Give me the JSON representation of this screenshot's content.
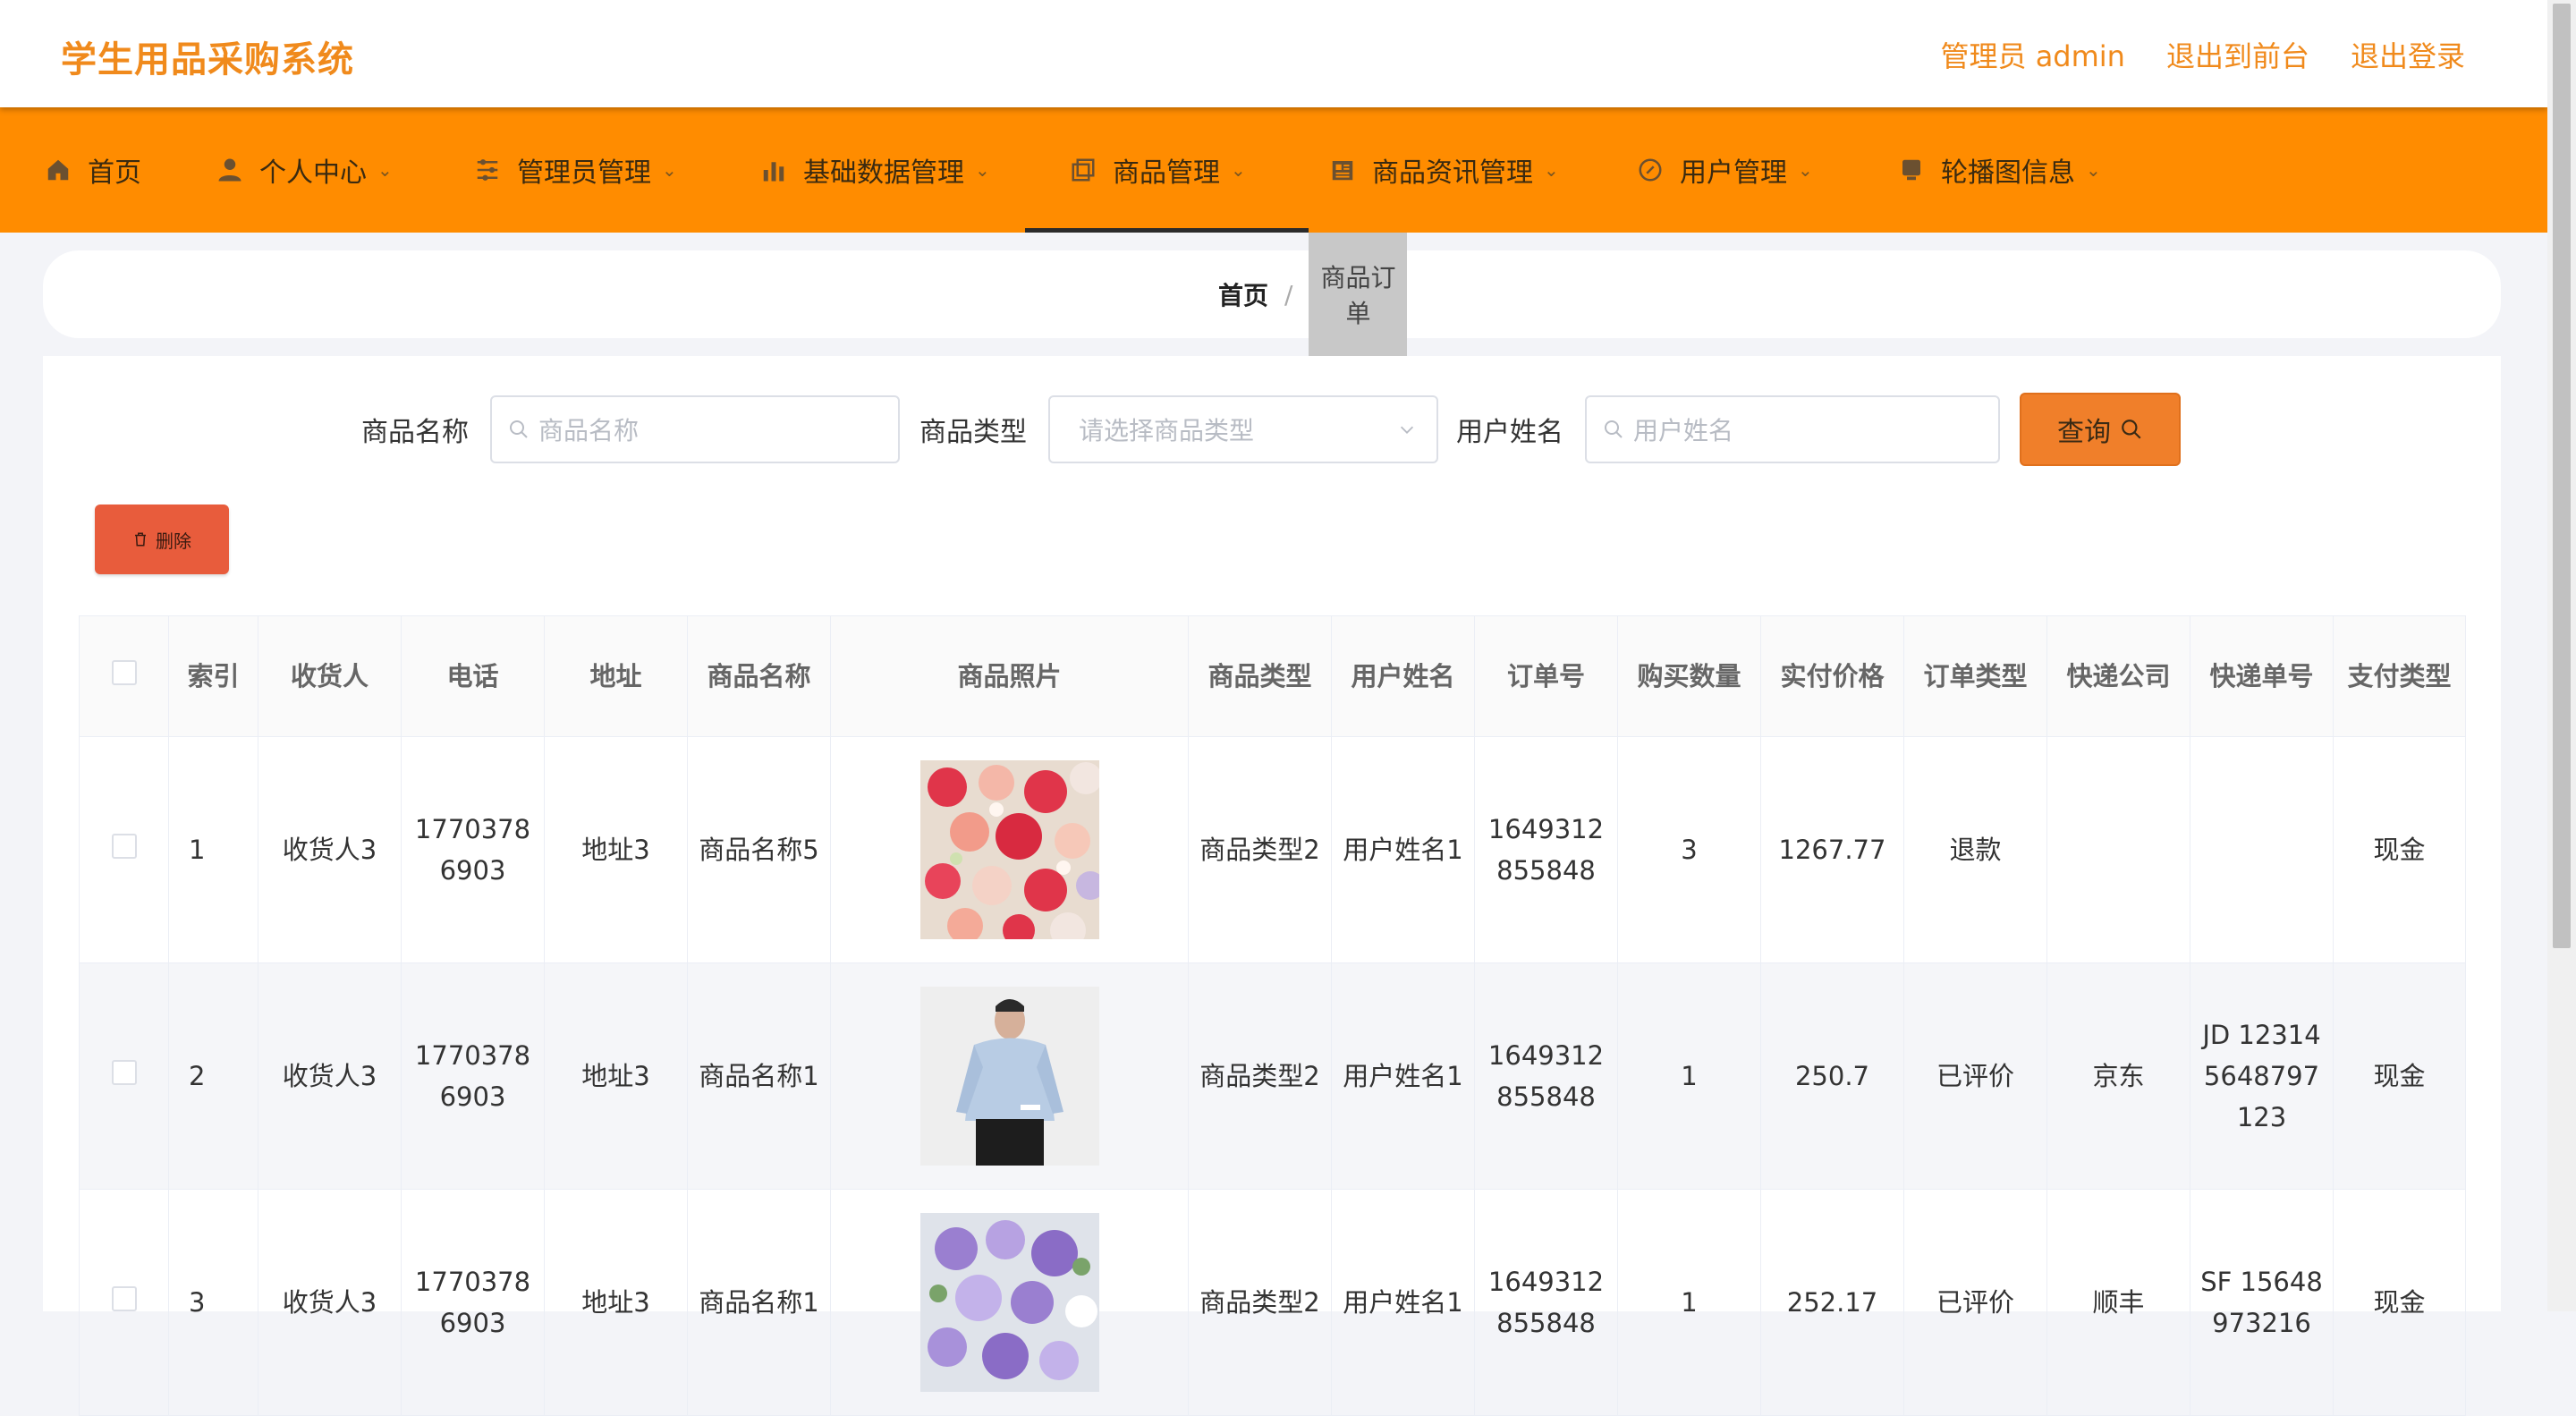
{
  "app": {
    "title": "学生用品采购系统"
  },
  "header_links": [
    "管理员 admin",
    "退出到前台",
    "退出登录"
  ],
  "nav": [
    {
      "label": "首页",
      "icon": "home-icon"
    },
    {
      "label": "个人中心",
      "icon": "user-icon"
    },
    {
      "label": "管理员管理",
      "icon": "sliders-icon"
    },
    {
      "label": "基础数据管理",
      "icon": "bar-chart-icon"
    },
    {
      "label": "商品管理",
      "icon": "copy-icon",
      "active": true
    },
    {
      "label": "商品资讯管理",
      "icon": "news-icon"
    },
    {
      "label": "用户管理",
      "icon": "compass-icon"
    },
    {
      "label": "轮播图信息",
      "icon": "image-icon"
    }
  ],
  "breadcrumb": {
    "home": "首页",
    "current": "商品订单"
  },
  "search": {
    "name_label": "商品名称",
    "name_placeholder": "商品名称",
    "type_label": "商品类型",
    "type_placeholder": "请选择商品类型",
    "user_label": "用户姓名",
    "user_placeholder": "用户姓名",
    "query_label": "查询"
  },
  "delete_label": "删除",
  "table": {
    "columns": [
      "索引",
      "收货人",
      "电话",
      "地址",
      "商品名称",
      "商品照片",
      "商品类型",
      "用户姓名",
      "订单号",
      "购买数量",
      "实付价格",
      "订单类型",
      "快递公司",
      "快递单号",
      "支付类型"
    ],
    "rows": [
      {
        "index": "1",
        "receiver": "收货人3",
        "phone": "17703786903",
        "address": "地址3",
        "product": "商品名称5",
        "photo": "flowers-red",
        "ptype": "商品类型2",
        "user": "用户姓名1",
        "order_no": "1649312855848",
        "qty": "3",
        "price": "1267.77",
        "otype": "退款",
        "courier": "",
        "tracking": "",
        "pay": "现金"
      },
      {
        "index": "2",
        "receiver": "收货人3",
        "phone": "17703786903",
        "address": "地址3",
        "product": "商品名称1",
        "photo": "man-shirt",
        "ptype": "商品类型2",
        "user": "用户姓名1",
        "order_no": "1649312855848",
        "qty": "1",
        "price": "250.7",
        "otype": "已评价",
        "courier": "京东",
        "tracking": "JD 123145648797123",
        "pay": "现金"
      },
      {
        "index": "3",
        "receiver": "收货人3",
        "phone": "17703786903",
        "address": "地址3",
        "product": "商品名称1",
        "photo": "flowers-purple",
        "ptype": "商品类型2",
        "user": "用户姓名1",
        "order_no": "1649312855848",
        "qty": "1",
        "price": "252.17",
        "otype": "已评价",
        "courier": "顺丰",
        "tracking": "SF 15648973216",
        "pay": "现金"
      }
    ]
  },
  "colors": {
    "accent": "#ff8c00",
    "title": "#f08a1c",
    "danger": "#e85c3c"
  }
}
